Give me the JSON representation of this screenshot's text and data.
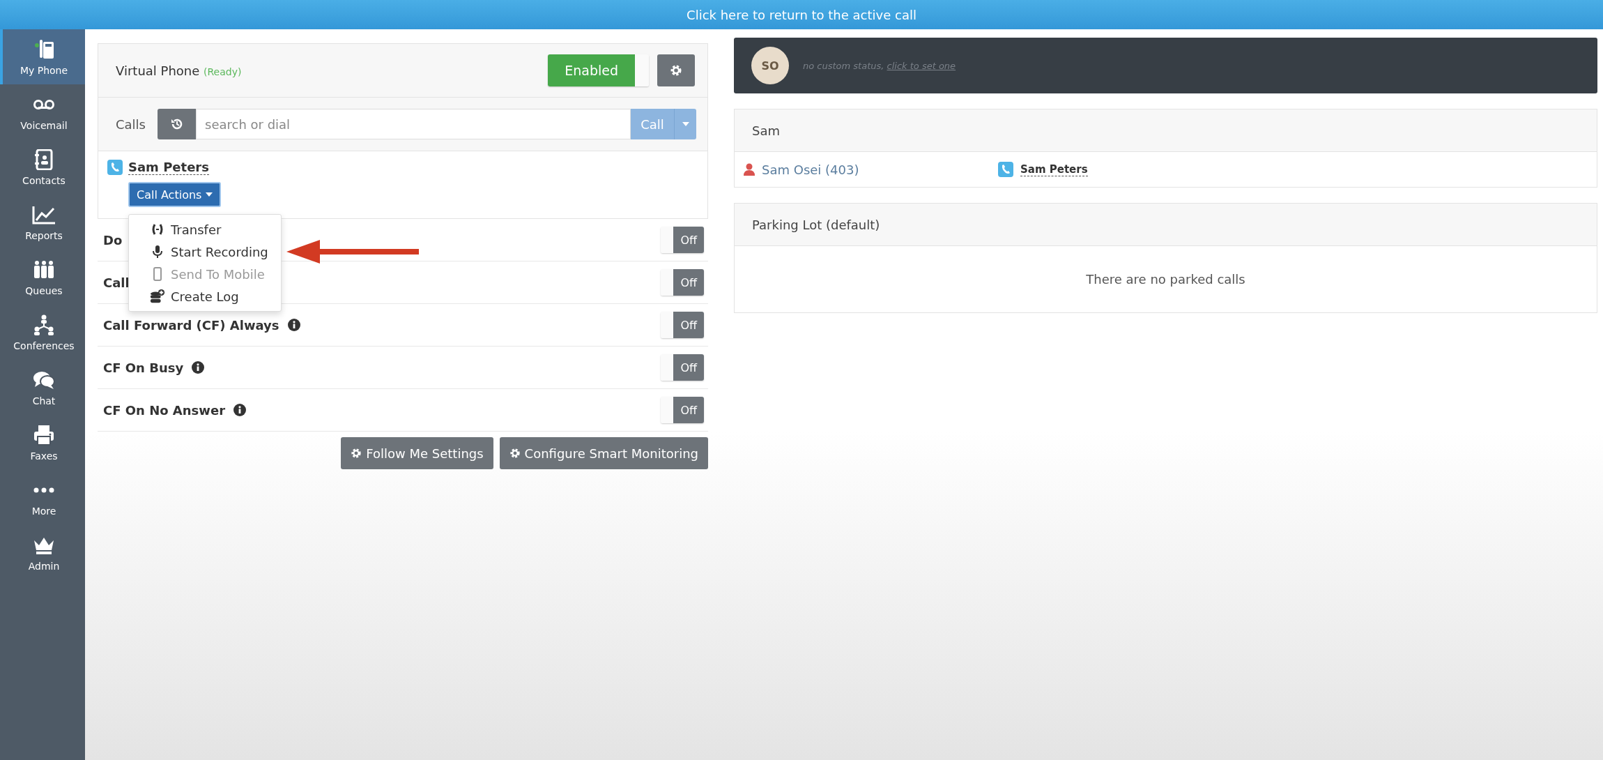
{
  "banner": {
    "text": "Click here to return to the active call"
  },
  "sidebar": {
    "items": [
      {
        "label": "My Phone",
        "selected": true
      },
      {
        "label": "Voicemail",
        "selected": false
      },
      {
        "label": "Contacts",
        "selected": false
      },
      {
        "label": "Reports",
        "selected": false
      },
      {
        "label": "Queues",
        "selected": false
      },
      {
        "label": "Conferences",
        "selected": false
      },
      {
        "label": "Chat",
        "selected": false
      },
      {
        "label": "Faxes",
        "selected": false
      },
      {
        "label": "More",
        "selected": false
      },
      {
        "label": "Admin",
        "selected": false
      }
    ]
  },
  "virtual_phone": {
    "title": "Virtual Phone",
    "status": "(Ready)",
    "toggle": {
      "label": "Enabled",
      "on": true
    }
  },
  "calls": {
    "label": "Calls",
    "placeholder": "search or dial",
    "call_button": "Call"
  },
  "active_call": {
    "name": "Sam Peters",
    "actions_button": "Call Actions",
    "menu": [
      {
        "label": "Transfer",
        "disabled": false
      },
      {
        "label": "Start Recording",
        "disabled": false
      },
      {
        "label": "Send To Mobile",
        "disabled": true
      },
      {
        "label": "Create Log",
        "disabled": false
      }
    ]
  },
  "settings": [
    {
      "label": "Do",
      "on": false,
      "state": "Off"
    },
    {
      "label": "Call",
      "on": false,
      "state": "Off"
    },
    {
      "label": "Call Forward (CF) Always",
      "info": true,
      "on": false,
      "state": "Off"
    },
    {
      "label": "CF On Busy",
      "info": true,
      "on": false,
      "state": "Off"
    },
    {
      "label": "CF On No Answer",
      "info": true,
      "on": false,
      "state": "Off"
    }
  ],
  "buttons": [
    "Follow Me Settings",
    "Configure Smart Monitoring"
  ],
  "presence": {
    "initials": "SO",
    "status": "no custom status, ",
    "link": "click to set one"
  },
  "group": {
    "title": "Sam",
    "member": "Sam Osei (403)",
    "call": "Sam Peters"
  },
  "parking": {
    "title": "Parking Lot (default)",
    "empty": "There are no parked calls"
  }
}
